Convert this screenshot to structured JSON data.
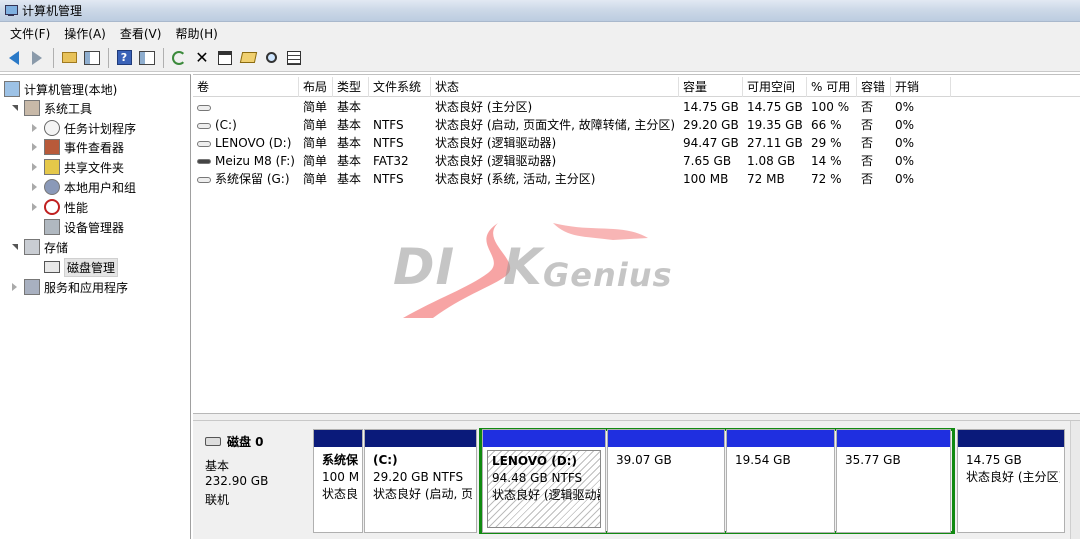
{
  "window": {
    "title": "计算机管理"
  },
  "menu": [
    {
      "label": "文件(F)"
    },
    {
      "label": "操作(A)"
    },
    {
      "label": "查看(V)"
    },
    {
      "label": "帮助(H)"
    }
  ],
  "toolbar": {
    "icons": [
      "back-icon",
      "forward-icon",
      "up-folder-icon",
      "show-hide-tree-icon",
      "help-icon",
      "show-action-pane-icon",
      "refresh-icon",
      "delete-icon",
      "properties-icon",
      "open-icon",
      "search-icon",
      "export-list-icon"
    ]
  },
  "tree": {
    "root": "计算机管理(本地)",
    "items": [
      {
        "label": "系统工具"
      },
      {
        "label": "任务计划程序"
      },
      {
        "label": "事件查看器"
      },
      {
        "label": "共享文件夹"
      },
      {
        "label": "本地用户和组"
      },
      {
        "label": "性能"
      },
      {
        "label": "设备管理器"
      },
      {
        "label": "存储"
      },
      {
        "label": "磁盘管理"
      },
      {
        "label": "服务和应用程序"
      }
    ]
  },
  "volumes": {
    "columns": [
      "卷",
      "布局",
      "类型",
      "文件系统",
      "状态",
      "容量",
      "可用空间",
      "% 可用",
      "容错",
      "开销"
    ],
    "rows": [
      {
        "name": "",
        "layout": "简单",
        "type": "基本",
        "fs": "",
        "status": "状态良好 (主分区)",
        "capacity": "14.75 GB",
        "free": "14.75 GB",
        "pct": "100 %",
        "fault": "否",
        "overhead": "0%"
      },
      {
        "name": "(C:)",
        "layout": "简单",
        "type": "基本",
        "fs": "NTFS",
        "status": "状态良好 (启动, 页面文件, 故障转储, 主分区)",
        "capacity": "29.20 GB",
        "free": "19.35 GB",
        "pct": "66 %",
        "fault": "否",
        "overhead": "0%"
      },
      {
        "name": "LENOVO (D:)",
        "layout": "简单",
        "type": "基本",
        "fs": "NTFS",
        "status": "状态良好 (逻辑驱动器)",
        "capacity": "94.47 GB",
        "free": "27.11 GB",
        "pct": "29 %",
        "fault": "否",
        "overhead": "0%"
      },
      {
        "name": "Meizu M8 (F:)",
        "layout": "简单",
        "type": "基本",
        "fs": "FAT32",
        "status": "状态良好 (逻辑驱动器)",
        "capacity": "7.65 GB",
        "free": "1.08 GB",
        "pct": "14 %",
        "fault": "否",
        "overhead": "0%"
      },
      {
        "name": "系统保留 (G:)",
        "layout": "简单",
        "type": "基本",
        "fs": "NTFS",
        "status": "状态良好 (系统, 活动, 主分区)",
        "capacity": "100 MB",
        "free": "72 MB",
        "pct": "72 %",
        "fault": "否",
        "overhead": "0%"
      }
    ]
  },
  "watermark": {
    "left": "DI",
    "mid": "K",
    "right": "Genius"
  },
  "disk0": {
    "name": "磁盘 0",
    "type": "基本",
    "size": "232.90 GB",
    "state": "联机",
    "partitions": [
      {
        "title": "系统保",
        "line1": "100 M",
        "line2": "状态良"
      },
      {
        "title": "(C:)",
        "line1": "29.20 GB NTFS",
        "line2": "状态良好 (启动, 页"
      },
      {
        "title": "LENOVO  (D:)",
        "line1": "94.48 GB NTFS",
        "line2": "状态良好 (逻辑驱动器"
      },
      {
        "title": "",
        "line1": "39.07 GB",
        "line2": ""
      },
      {
        "title": "",
        "line1": "19.54 GB",
        "line2": ""
      },
      {
        "title": "",
        "line1": "35.77 GB",
        "line2": ""
      },
      {
        "title": "",
        "line1": "14.75 GB",
        "line2": "状态良好 (主分区)"
      }
    ]
  },
  "colors": {
    "primary_bar": "#0a1a7a",
    "logical_bar": "#1f2fe0",
    "extended_border": "#118a11"
  }
}
